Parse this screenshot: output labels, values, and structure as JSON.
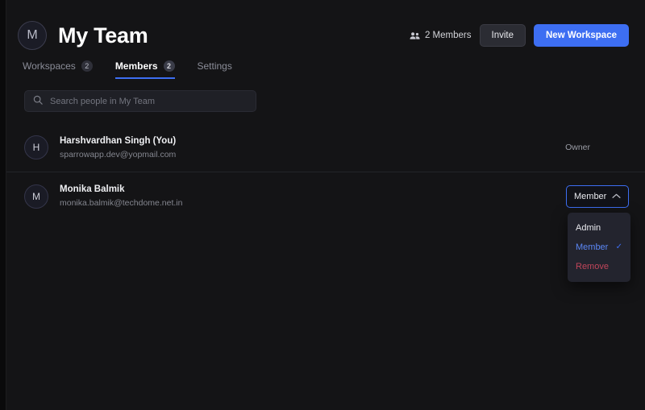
{
  "team": {
    "avatar_initial": "M",
    "title": "My Team"
  },
  "header": {
    "members_count_label": "2 Members",
    "members_icon": "people-icon",
    "invite_label": "Invite",
    "new_workspace_label": "New Workspace",
    "accent_color": "#3d6ef2"
  },
  "tabs": [
    {
      "label": "Workspaces",
      "badge": "2",
      "active": false
    },
    {
      "label": "Members",
      "badge": "2",
      "active": true
    },
    {
      "label": "Settings",
      "badge": "",
      "active": false
    }
  ],
  "search": {
    "placeholder": "Search people in My Team",
    "value": "",
    "icon": "search-icon"
  },
  "members": [
    {
      "avatar_initial": "H",
      "name": "Harshvardhan Singh (You)",
      "email": "sparrowapp.dev@yopmail.com",
      "role_label": "Owner",
      "role_type": "static"
    },
    {
      "avatar_initial": "M",
      "name": "Monika Balmik",
      "email": "monika.balmik@techdome.net.in",
      "role_label": "Member",
      "role_type": "dropdown",
      "dropdown_open": true,
      "chevron": "chevron-up-icon"
    }
  ],
  "role_menu": {
    "options": [
      {
        "label": "Admin",
        "selected": false,
        "danger": false
      },
      {
        "label": "Member",
        "selected": true,
        "danger": false
      },
      {
        "label": "Remove",
        "selected": false,
        "danger": true
      }
    ],
    "check_glyph": "✓"
  }
}
